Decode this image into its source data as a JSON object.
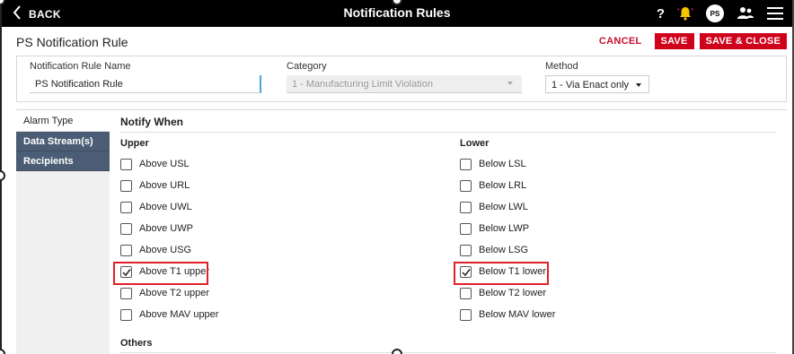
{
  "header": {
    "back_label": "BACK",
    "title": "Notification Rules",
    "help_label": "?",
    "avatar_initials": "PS",
    "icons": [
      "chevron-left-icon",
      "help-icon",
      "alarm-bell-icon",
      "people-icon",
      "hamburger-menu-icon"
    ]
  },
  "page": {
    "title": "PS Notification Rule",
    "cancel_label": "CANCEL",
    "save_label": "SAVE",
    "save_close_label": "SAVE & CLOSE"
  },
  "form": {
    "name_label": "Notification Rule Name",
    "name_value": "PS Notification Rule",
    "category_label": "Category",
    "category_value": "1 - Manufacturing Limit Violation",
    "method_label": "Method",
    "method_value": "1 - Via Enact only"
  },
  "sidebar": {
    "items": [
      {
        "label": "Alarm Type",
        "active": true
      },
      {
        "label": "Data Stream(s)",
        "active": false
      },
      {
        "label": "Recipients",
        "active": false
      }
    ]
  },
  "notify": {
    "title": "Notify When",
    "upper_head": "Upper",
    "lower_head": "Lower",
    "upper": [
      {
        "label": "Above USL",
        "checked": false
      },
      {
        "label": "Above URL",
        "checked": false
      },
      {
        "label": "Above UWL",
        "checked": false
      },
      {
        "label": "Above UWP",
        "checked": false
      },
      {
        "label": "Above USG",
        "checked": false
      },
      {
        "label": "Above T1 upper",
        "checked": true
      },
      {
        "label": "Above T2 upper",
        "checked": false
      },
      {
        "label": "Above MAV upper",
        "checked": false
      }
    ],
    "lower": [
      {
        "label": "Below LSL",
        "checked": false
      },
      {
        "label": "Below LRL",
        "checked": false
      },
      {
        "label": "Below LWL",
        "checked": false
      },
      {
        "label": "Below LWP",
        "checked": false
      },
      {
        "label": "Below LSG",
        "checked": false
      },
      {
        "label": "Below T1 lower",
        "checked": true
      },
      {
        "label": "Below T2 lower",
        "checked": false
      },
      {
        "label": "Below MAV lower",
        "checked": false
      }
    ],
    "others_head": "Others"
  },
  "colors": {
    "topbar": "#000000",
    "accent_red": "#d0021b",
    "sidebar_blue": "#4b5d74",
    "highlight": "#e0202a"
  }
}
